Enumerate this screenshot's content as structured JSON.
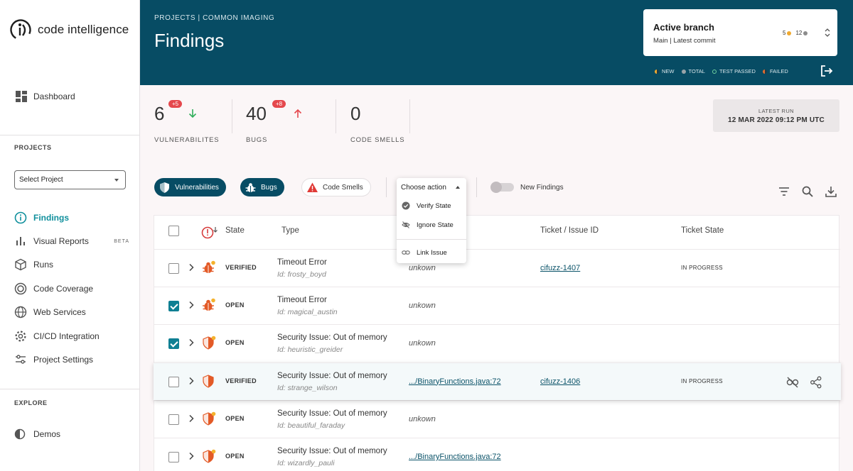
{
  "brand": {
    "name": "code intelligence"
  },
  "sidebar": {
    "dashboard": "Dashboard",
    "projects_label": "PROJECTS",
    "select_project": "Select Project",
    "items": [
      {
        "label": "Findings",
        "icon": "info-circle-icon",
        "active": true
      },
      {
        "label": "Visual Reports",
        "icon": "bar-chart-icon",
        "badge": "BETA"
      },
      {
        "label": "Runs",
        "icon": "cube-icon"
      },
      {
        "label": "Code Coverage",
        "icon": "coverage-icon"
      },
      {
        "label": "Web Services",
        "icon": "globe-icon"
      },
      {
        "label": "CI/CD Integration",
        "icon": "gear-icon"
      },
      {
        "label": "Project Settings",
        "icon": "sliders-icon"
      }
    ],
    "explore_label": "EXPLORE",
    "demos": "Demos"
  },
  "header": {
    "breadcrumb": "PROJECTS |  COMMON IMAGING",
    "title": "Findings",
    "branch": {
      "title": "Active branch",
      "subtitle": "Main | Latest commit",
      "count_new": "5",
      "count_total": "12"
    },
    "legend": {
      "new": "NEW",
      "total": "TOTAL",
      "passed": "TEST PASSED",
      "failed": "FAILED"
    }
  },
  "stats": {
    "vulnerabilities": {
      "value": "6",
      "delta": "+5",
      "label": "VULNERABILITES"
    },
    "bugs": {
      "value": "40",
      "delta": "+8",
      "label": "BUGS"
    },
    "code_smells": {
      "value": "0",
      "label": "CODE SMELLS"
    },
    "latest_run": {
      "label": "LATEST RUN",
      "value": "12 MAR 2022 09:12 PM UTC"
    }
  },
  "filters": {
    "vulnerabilities": "Vulnerabilities",
    "bugs": "Bugs",
    "code_smells": "Code Smells",
    "action": {
      "label": "Choose action",
      "items": [
        "Verify State",
        "Ignore State",
        "Link Issue"
      ]
    },
    "new_findings": "New Findings"
  },
  "table": {
    "headers": {
      "state": "State",
      "type": "Type",
      "ticket": "Ticket / Issue ID",
      "ticket_state": "Ticket State"
    },
    "rows": [
      {
        "checked": false,
        "kind": "bug",
        "state": "VERIFIED",
        "type": "Timeout Error",
        "id": "Id: frosty_boyd",
        "location": "unkown",
        "ticket": "cifuzz-1407",
        "ticket_state": "IN PROGRESS"
      },
      {
        "checked": true,
        "kind": "bug",
        "state": "OPEN",
        "type": "Timeout Error",
        "id": "Id: magical_austin",
        "location": "unkown",
        "ticket": "",
        "ticket_state": ""
      },
      {
        "checked": true,
        "kind": "shield",
        "state": "OPEN",
        "type": "Security Issue: Out of memory",
        "id": "Id: heuristic_greider",
        "location": "unkown",
        "ticket": "",
        "ticket_state": ""
      },
      {
        "checked": false,
        "kind": "shield",
        "state": "VERIFIED",
        "type": "Security Issue: Out of memory",
        "id": "Id: strange_wilson",
        "location": ".../BinaryFunctions.java:72",
        "ticket": "cifuzz-1406",
        "ticket_state": "IN PROGRESS"
      },
      {
        "checked": false,
        "kind": "shield",
        "state": "OPEN",
        "type": "Security Issue: Out of memory",
        "id": "Id: beautiful_faraday",
        "location": "unkown",
        "ticket": "",
        "ticket_state": ""
      },
      {
        "checked": false,
        "kind": "shield",
        "state": "OPEN",
        "type": "Security Issue: Out of memory",
        "id": "Id: wizardly_pauli",
        "location": ".../BinaryFunctions.java:72",
        "ticket": "",
        "ticket_state": ""
      }
    ]
  },
  "colors": {
    "header": "#074c64",
    "accent": "#0f8f9c",
    "alert": "#e5484d",
    "new_dot": "#f0a92e"
  }
}
